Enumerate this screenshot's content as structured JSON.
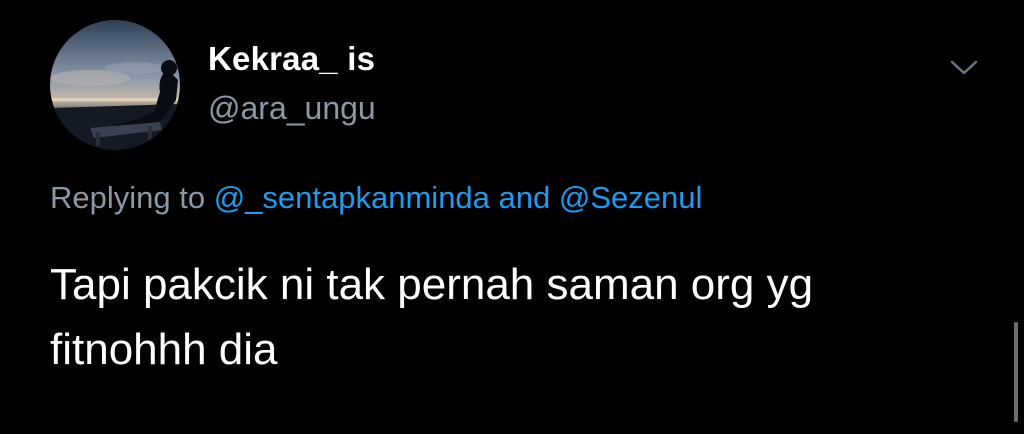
{
  "tweet": {
    "author": {
      "display_name": "Kekraa_ is",
      "handle": "@ara_ungu"
    },
    "replying": {
      "prefix": "Replying to",
      "mention_1": "@_sentapkanminda",
      "joiner": "and",
      "mention_2": "@Sezenul"
    },
    "text_lines": [
      "Tapi pakcik ni tak pernah saman org yg",
      "fitnohhh dia"
    ]
  },
  "icons": {
    "menu": "chevron-down-icon",
    "avatar": "avatar-photo"
  },
  "colors": {
    "background": "#000000",
    "primary_text": "#ffffff",
    "secondary_text": "#8b98a5",
    "link": "#1d9bf0"
  }
}
